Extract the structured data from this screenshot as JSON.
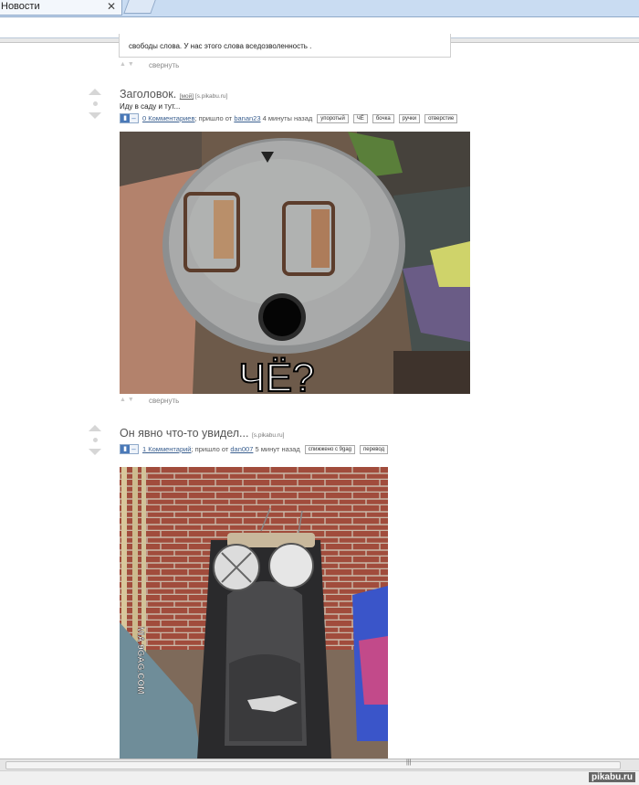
{
  "browser": {
    "tab_title": "Новости",
    "tab_close": "✕"
  },
  "prev_post": {
    "text_tail": "свободы слова. У нас этого слова вседозволенность .",
    "collapse_label": "свернуть"
  },
  "posts": [
    {
      "title": "Заголовок.",
      "title_link_mine": "[мой]",
      "source": "[s.pikabu.ru]",
      "description": "Иду в саду и тут...",
      "comments": "0 Комментариев",
      "came_from_prefix": "; пришло от",
      "author": "banan23",
      "time": "4 минуты назад",
      "tags": [
        "упоротый",
        "ЧЁ",
        "бочка",
        "ручки",
        "отверстие"
      ],
      "image_caption": "ЧЁ?",
      "collapse_label": "свернуть"
    },
    {
      "title": "Он явно что-то увидел...",
      "source": "[s.pikabu.ru]",
      "comments": "1 Комментарий",
      "came_from_prefix": "; пришло от",
      "author": "dan007",
      "time": "5 минут назад",
      "tags": [
        "спижжено с 9gag",
        "перевод"
      ],
      "image_watermark": "VIA 9GAG.COM"
    }
  ],
  "footer": {
    "scroll_grip": "|||",
    "watermark": "pikabu.ru"
  }
}
